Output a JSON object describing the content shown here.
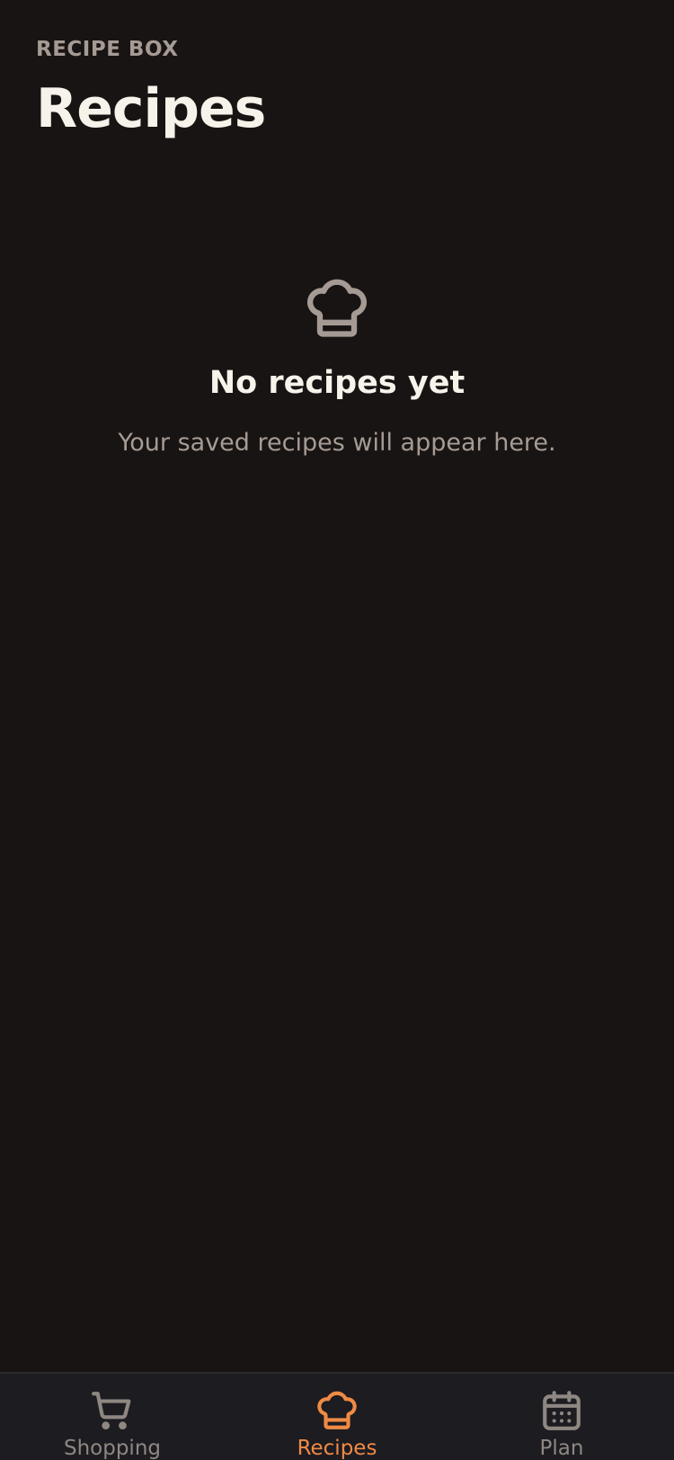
{
  "header": {
    "eyebrow": "RECIPE BOX",
    "title": "Recipes"
  },
  "empty_state": {
    "icon": "chef-hat-icon",
    "title": "No recipes yet",
    "subtitle": "Your saved recipes will appear here."
  },
  "tabs": [
    {
      "label": "Shopping",
      "icon": "shopping-cart-icon",
      "active": false
    },
    {
      "label": "Recipes",
      "icon": "chef-hat-icon",
      "active": true
    },
    {
      "label": "Plan",
      "icon": "calendar-icon",
      "active": false
    }
  ],
  "colors": {
    "background": "#181413",
    "tabbar": "#1d1c21",
    "accent": "#f08a45",
    "muted": "#a69b94",
    "text": "#f7f2ea"
  }
}
